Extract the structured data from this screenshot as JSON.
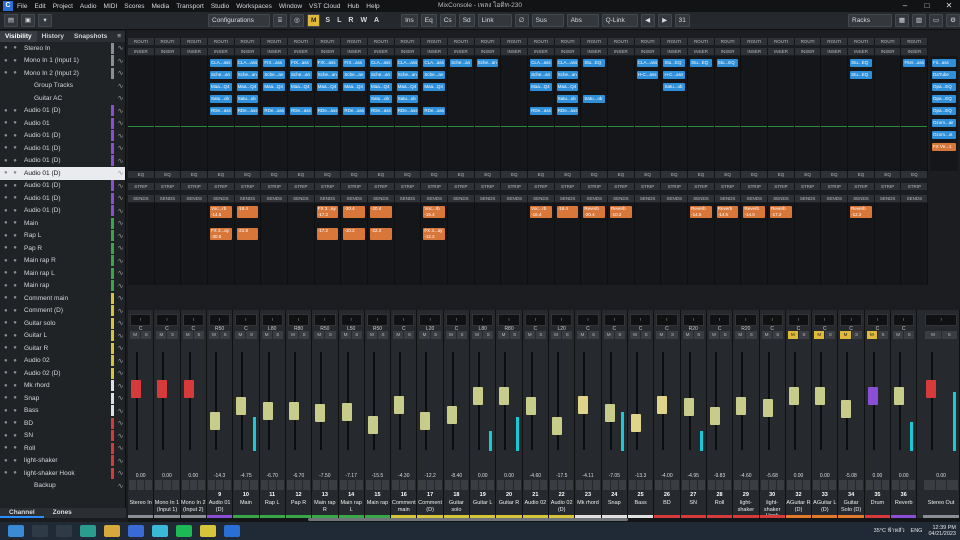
{
  "titlebar": {
    "menus": [
      "File",
      "Edit",
      "Project",
      "Audio",
      "MIDI",
      "Scores",
      "Media",
      "Transport",
      "Studio",
      "Workspaces",
      "Window",
      "VST Cloud",
      "Hub",
      "Help"
    ],
    "title": "MixConsole - เพลง ไอดิท-230"
  },
  "toolbar": {
    "configurations": "Configurations",
    "m": "M",
    "s": "S",
    "l": "L",
    "r": "R",
    "w": "W",
    "a": "A",
    "ins": "Ins",
    "eq": "Eq",
    "cs": "Cs",
    "sd": "Sd",
    "link": "Link",
    "sus": "Sus",
    "abs": "Abs",
    "qlink": "Q-Link",
    "count": "31",
    "racks": "Racks"
  },
  "left": {
    "tabs": [
      "Visibility",
      "History",
      "Snapshots"
    ],
    "bottom_tabs": [
      "Channel",
      "Zones"
    ],
    "rows": [
      {
        "name": "Stereo In",
        "color": "#8a8f96"
      },
      {
        "name": "Mono In 1 (Input 1)",
        "color": "#8a8f96"
      },
      {
        "name": "Mono In 2 (Input 2)",
        "color": "#8a8f96"
      },
      {
        "name": "Group Tracks",
        "color": "#202326"
      },
      {
        "name": "Guitar AC",
        "color": "#202326"
      },
      {
        "name": "Audio 01 (D)",
        "color": "#8a4fd6"
      },
      {
        "name": "Audio 01",
        "color": "#8a4fd6"
      },
      {
        "name": "Audio 01 (D)",
        "color": "#8a4fd6"
      },
      {
        "name": "Audio 01 (D)",
        "color": "#8a4fd6"
      },
      {
        "name": "Audio 01 (D)",
        "color": "#8a4fd6"
      },
      {
        "name": "Audio 01 (D)",
        "color": "#e9ebee"
      },
      {
        "name": "Audio 01 (D)",
        "color": "#8a4fd6"
      },
      {
        "name": "Audio 01 (D)",
        "color": "#8a4fd6"
      },
      {
        "name": "Audio 01 (D)",
        "color": "#8a4fd6"
      },
      {
        "name": "Main",
        "color": "#3aa64a"
      },
      {
        "name": "Rap L",
        "color": "#3aa64a"
      },
      {
        "name": "Pap R",
        "color": "#3aa64a"
      },
      {
        "name": "Main rap R",
        "color": "#3aa64a"
      },
      {
        "name": "Main rap L",
        "color": "#3aa64a"
      },
      {
        "name": "Main rap",
        "color": "#3aa64a"
      },
      {
        "name": "Comment main",
        "color": "#d6c53a"
      },
      {
        "name": "Comment (D)",
        "color": "#d6c53a"
      },
      {
        "name": "Guitar solo",
        "color": "#d6c53a"
      },
      {
        "name": "Guitar L",
        "color": "#d6c53a"
      },
      {
        "name": "Guitar R",
        "color": "#d6c53a"
      },
      {
        "name": "Audio 02",
        "color": "#d6c53a"
      },
      {
        "name": "Audio 02 (D)",
        "color": "#d6c53a"
      },
      {
        "name": "Mk rhord",
        "color": "#e0e0e0"
      },
      {
        "name": "Snap",
        "color": "#e0e0e0"
      },
      {
        "name": "Bass",
        "color": "#e0e0e0"
      },
      {
        "name": "BD",
        "color": "#d63a3a"
      },
      {
        "name": "SN",
        "color": "#d63a3a"
      },
      {
        "name": "Roll",
        "color": "#d63a3a"
      },
      {
        "name": "light-shaker",
        "color": "#d63a3a"
      },
      {
        "name": "light-shaker Hook",
        "color": "#d63a3a"
      },
      {
        "name": "Backup",
        "color": "#202326"
      }
    ]
  },
  "racks": {
    "routing": "ROUTI",
    "inserts": "INSER",
    "eq": "EQ",
    "strip": "STRIP",
    "sends": "SENDS"
  },
  "channels": [
    {
      "name": "Stereo In",
      "num": "",
      "db": "0.00",
      "color": "#8a8f96",
      "cap": "#d63a3a",
      "fader": 0.62,
      "meter": 0.0,
      "pan": "C"
    },
    {
      "name": "Mono In 1 (Input 1)",
      "num": "",
      "db": "0.00",
      "color": "#8a8f96",
      "cap": "#d63a3a",
      "fader": 0.62,
      "meter": 0.0,
      "pan": "C"
    },
    {
      "name": "Mono In 2 (Input 2)",
      "num": "",
      "db": "0.00",
      "color": "#8a8f96",
      "cap": "#d63a3a",
      "fader": 0.62,
      "meter": 0.0,
      "pan": "C"
    },
    {
      "name": "Audio 01 (D)",
      "num": "9",
      "db": "-14.3",
      "color": "#8a4fd6",
      "cap": "#c8cc8a",
      "fader": 0.3,
      "meter": 0.0,
      "pan": "R50"
    },
    {
      "name": "Main",
      "num": "10",
      "db": "-4.75",
      "color": "#3aa64a",
      "cap": "#c8cc8a",
      "fader": 0.45,
      "meter": 0.35,
      "pan": "C"
    },
    {
      "name": "Rap L",
      "num": "11",
      "db": "-6.70",
      "color": "#3aa64a",
      "cap": "#c8cc8a",
      "fader": 0.4,
      "meter": 0.0,
      "pan": "L80"
    },
    {
      "name": "Pap R",
      "num": "12",
      "db": "-6.70",
      "color": "#3aa64a",
      "cap": "#c8cc8a",
      "fader": 0.4,
      "meter": 0.0,
      "pan": "R80"
    },
    {
      "name": "Main rap R",
      "num": "13",
      "db": "-7.50",
      "color": "#3aa64a",
      "cap": "#c8cc8a",
      "fader": 0.38,
      "meter": 0.0,
      "pan": "R50"
    },
    {
      "name": "Main rap L",
      "num": "14",
      "db": "-7.17",
      "color": "#3aa64a",
      "cap": "#c8cc8a",
      "fader": 0.39,
      "meter": 0.0,
      "pan": "L50"
    },
    {
      "name": "Main rap",
      "num": "15",
      "db": "-15.5",
      "color": "#3aa64a",
      "cap": "#c8cc8a",
      "fader": 0.26,
      "meter": 0.0,
      "pan": "R50"
    },
    {
      "name": "Comment main",
      "num": "16",
      "db": "-4.30",
      "color": "#d6c53a",
      "cap": "#c8cc8a",
      "fader": 0.46,
      "meter": 0.0,
      "pan": "C"
    },
    {
      "name": "Comment (D)",
      "num": "17",
      "db": "-12.2",
      "color": "#d6c53a",
      "cap": "#c8cc8a",
      "fader": 0.3,
      "meter": 0.0,
      "pan": "L20"
    },
    {
      "name": "Guitar solo",
      "num": "18",
      "db": "-8.40",
      "color": "#d6c53a",
      "cap": "#c8cc8a",
      "fader": 0.36,
      "meter": 0.0,
      "pan": "C"
    },
    {
      "name": "Guitar L",
      "num": "19",
      "db": "0.00",
      "color": "#d6c53a",
      "cap": "#c8cc8a",
      "fader": 0.55,
      "meter": 0.2,
      "pan": "L80"
    },
    {
      "name": "Guitar R",
      "num": "20",
      "db": "0.00",
      "color": "#d6c53a",
      "cap": "#c8cc8a",
      "fader": 0.55,
      "meter": 0.35,
      "pan": "R80"
    },
    {
      "name": "Audio 02",
      "num": "21",
      "db": "-4.60",
      "color": "#d6c53a",
      "cap": "#c8cc8a",
      "fader": 0.45,
      "meter": 0.0,
      "pan": "C"
    },
    {
      "name": "Audio 02 (D)",
      "num": "22",
      "db": "-17.5",
      "color": "#d6c53a",
      "cap": "#c8cc8a",
      "fader": 0.24,
      "meter": 0.0,
      "pan": "L20"
    },
    {
      "name": "Mk rhord",
      "num": "23",
      "db": "-4.11",
      "color": "#e0e0e0",
      "cap": "#e0d48a",
      "fader": 0.46,
      "meter": 0.0,
      "pan": "C"
    },
    {
      "name": "Snap",
      "num": "24",
      "db": "-7.05",
      "color": "#e0e0e0",
      "cap": "#c8cc8a",
      "fader": 0.38,
      "meter": 0.4,
      "pan": "C"
    },
    {
      "name": "Bass",
      "num": "25",
      "db": "-13.3",
      "color": "#e0e0e0",
      "cap": "#e0d48a",
      "fader": 0.28,
      "meter": 0.0,
      "pan": "C"
    },
    {
      "name": "BD",
      "num": "26",
      "db": "-4.00",
      "color": "#d63a3a",
      "cap": "#e0d48a",
      "fader": 0.46,
      "meter": 0.0,
      "pan": "C"
    },
    {
      "name": "SN",
      "num": "27",
      "db": "-4.95",
      "color": "#d63a3a",
      "cap": "#c8cc8a",
      "fader": 0.44,
      "meter": 0.2,
      "pan": "R20"
    },
    {
      "name": "Roll",
      "num": "28",
      "db": "-9.83",
      "color": "#d63a3a",
      "cap": "#c8cc8a",
      "fader": 0.35,
      "meter": 0.0,
      "pan": "C"
    },
    {
      "name": "light-shaker",
      "num": "29",
      "db": "-4.60",
      "color": "#d63a3a",
      "cap": "#c8cc8a",
      "fader": 0.45,
      "meter": 0.0,
      "pan": "R20"
    },
    {
      "name": "light-shaker Hook",
      "num": "30",
      "db": "-5.68",
      "color": "#d63a3a",
      "cap": "#c8cc8a",
      "fader": 0.43,
      "meter": 0.0,
      "pan": "C"
    },
    {
      "name": "AGuitar R (D)",
      "num": "32",
      "db": "0.00",
      "color": "#e07a2a",
      "cap": "#c8cc8a",
      "fader": 0.55,
      "meter": 0.0,
      "pan": "C"
    },
    {
      "name": "AGuitar L (D)",
      "num": "33",
      "db": "0.00",
      "color": "#e07a2a",
      "cap": "#c8cc8a",
      "fader": 0.55,
      "meter": 0.0,
      "pan": "C"
    },
    {
      "name": "Guitar Solo (D)",
      "num": "34",
      "db": "-5.08",
      "color": "#e07a2a",
      "cap": "#c8cc8a",
      "fader": 0.42,
      "meter": 0.0,
      "pan": "C"
    },
    {
      "name": "Drum",
      "num": "35",
      "db": "0.00",
      "color": "#d63a3a",
      "cap": "#8a4fd6",
      "fader": 0.55,
      "meter": 0.0,
      "pan": "C"
    },
    {
      "name": "Reverb",
      "num": "36",
      "db": "0.00",
      "color": "#8a4fd6",
      "cap": "#c8cc8a",
      "fader": 0.55,
      "meter": 0.3,
      "pan": "C"
    },
    {
      "name": "Stereo Out",
      "num": "",
      "db": "0.00",
      "color": "#8a8f96",
      "cap": "#d63a3a",
      "fader": 0.62,
      "meter": 0.6,
      "pan": ""
    }
  ],
  "inserts": [
    {
      "col": 3,
      "rows": [
        "CLA...ass",
        "Sche...an",
        "Maa...Q4",
        "Satu...ob",
        "RDe...ass"
      ]
    },
    {
      "col": 4,
      "rows": [
        "CLA...ass",
        "Sche...an",
        "Maa...Q4",
        "Satu...ob",
        "RDe...ass"
      ]
    },
    {
      "col": 5,
      "rows": [
        "FIX...ass",
        "Sche...an",
        "Maa...Q4",
        "",
        "RDe...ass"
      ]
    },
    {
      "col": 6,
      "rows": [
        "FIX...ass",
        "Sche...an",
        "Maa...Q4",
        "",
        "RDe...ass"
      ]
    },
    {
      "col": 7,
      "rows": [
        "FIX...ass",
        "Sche...an",
        "Maa...Q4",
        "",
        "RDe...ass"
      ]
    },
    {
      "col": 8,
      "rows": [
        "FIX...ass",
        "Sche...an",
        "Maa...Q4",
        "",
        "RDe...ass"
      ]
    },
    {
      "col": 9,
      "rows": [
        "CLA...ass",
        "Sche...an",
        "Maa...Q4",
        "Satu...ob",
        "RDe...ass"
      ]
    },
    {
      "col": 10,
      "rows": [
        "CLA...ass",
        "Sche...an",
        "Maa...Q4",
        "Satu...ob",
        "RDe...ass"
      ]
    },
    {
      "col": 11,
      "rows": [
        "CLA...ass",
        "Sche...an",
        "Maa...Q4",
        "",
        "RDe...ass"
      ]
    },
    {
      "col": 12,
      "rows": [
        "Sche...an",
        "",
        "",
        "",
        ""
      ]
    },
    {
      "col": 13,
      "rows": [
        "Sche...an",
        "",
        "",
        "",
        ""
      ]
    },
    {
      "col": 15,
      "rows": [
        "CLA...ass",
        "Sche...an",
        "Maa...Q4",
        "",
        "RDe...ass"
      ]
    },
    {
      "col": 16,
      "rows": [
        "CLA...ass",
        "Sche...an",
        "Maa...Q4",
        "Satu...ob",
        "RDe...ass"
      ]
    },
    {
      "col": 17,
      "rows": [
        "Stu...EQ",
        "",
        "",
        "Satu...ob",
        ""
      ]
    },
    {
      "col": 19,
      "rows": [
        "CLA...ass",
        "H-C...ass",
        "",
        "",
        ""
      ]
    },
    {
      "col": 20,
      "rows": [
        "Stu...EQ",
        "H-C...ass",
        "Satu...ob",
        "",
        ""
      ]
    },
    {
      "col": 21,
      "rows": [
        "Stu...EQ",
        "",
        "",
        "",
        ""
      ]
    },
    {
      "col": 22,
      "rows": [
        "Stu...EQ",
        "",
        "",
        "",
        ""
      ]
    },
    {
      "col": 27,
      "rows": [
        "Stu...EQ",
        "Stu...EQ",
        "",
        "",
        ""
      ]
    },
    {
      "col": 29,
      "rows": [
        "Fiter...ass",
        "",
        "",
        "",
        ""
      ]
    }
  ],
  "sends": [
    {
      "col": 3,
      "rows": [
        "Voc...rb -14.5",
        "FX 3...ay -30.5"
      ]
    },
    {
      "col": 4,
      "rows": [
        "-19.4",
        "-22.8"
      ]
    },
    {
      "col": 7,
      "rows": [
        "FX 3...ay -17.2",
        "-17.2"
      ]
    },
    {
      "col": 8,
      "rows": [
        "-20.4",
        "-10.2"
      ]
    },
    {
      "col": 9,
      "rows": [
        "-20.4",
        "-22.2"
      ]
    },
    {
      "col": 11,
      "rows": [
        "Voc...rb -15.4",
        "FX 3...ay -12.2"
      ]
    },
    {
      "col": 15,
      "rows": [
        "Voc...rb -16.4",
        "",
        ""
      ]
    },
    {
      "col": 16,
      "rows": [
        "-16.4",
        "",
        ""
      ]
    },
    {
      "col": 17,
      "rows": [
        "Reverb -20.4",
        "",
        ""
      ]
    },
    {
      "col": 18,
      "rows": [
        "Reverb -10.2",
        "",
        ""
      ]
    },
    {
      "col": 21,
      "rows": [
        "Reverb -14.5",
        "",
        ""
      ]
    },
    {
      "col": 22,
      "rows": [
        "Reverb -14.5",
        "",
        ""
      ]
    },
    {
      "col": 23,
      "rows": [
        "Reverb -14.5",
        "",
        ""
      ]
    },
    {
      "col": 24,
      "rows": [
        "Reverb -17.2",
        "",
        ""
      ]
    },
    {
      "col": 27,
      "rows": [
        "Reverb -12.2",
        "",
        ""
      ]
    }
  ],
  "rightstrip": [
    "Fit...ass",
    "DaTube",
    "Opa...EQ",
    "Opa...EQ",
    "Opa...EQ",
    "Ozom...air",
    "Ozom...ot",
    "FX Ve...1"
  ],
  "tray": {
    "weather": "35°C ฟ้าหลัว",
    "lang": "ENG",
    "time": "12:39 PM",
    "date": "04/21/2023"
  }
}
